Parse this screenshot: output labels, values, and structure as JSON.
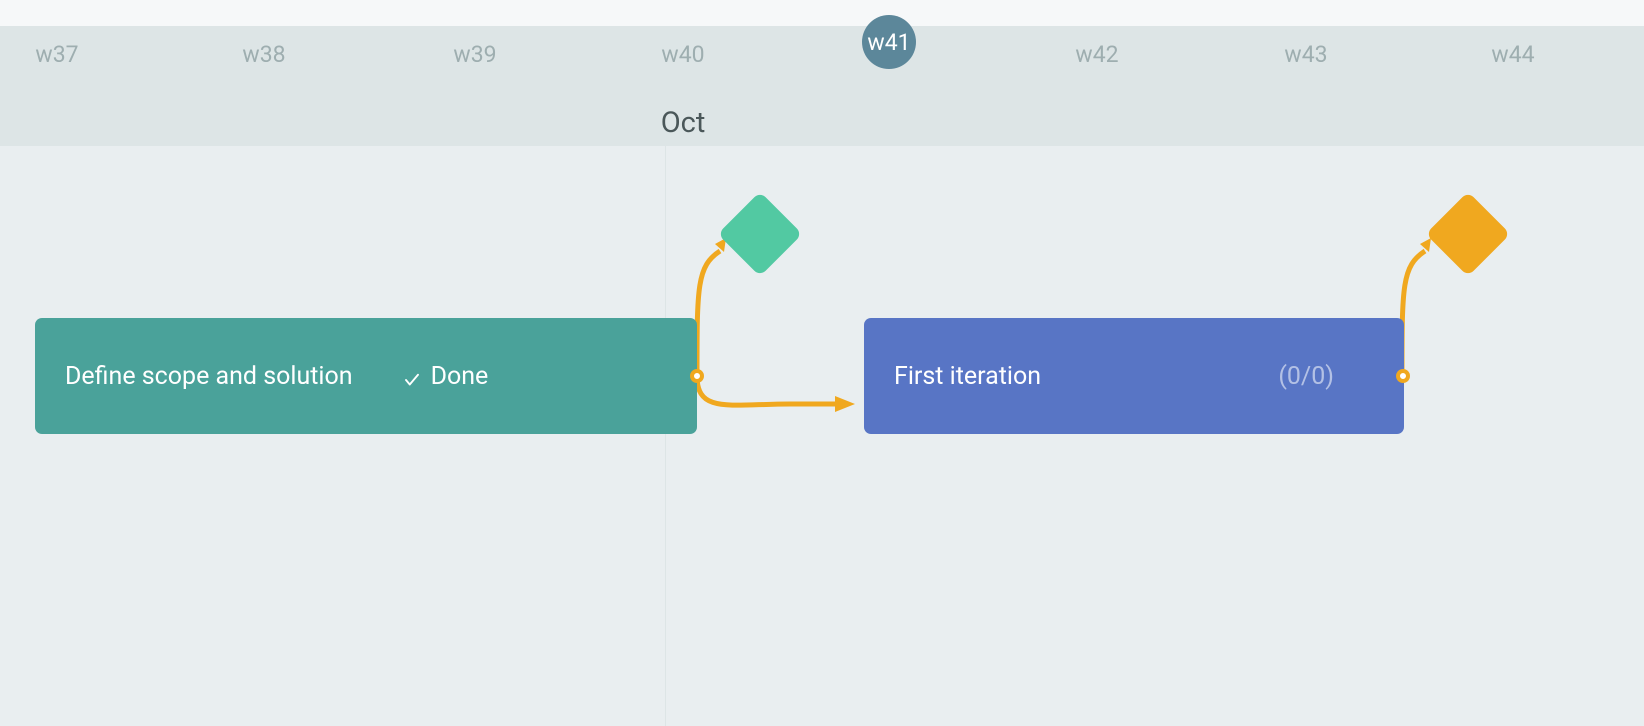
{
  "colors": {
    "accent_teal": "#4aa29a",
    "accent_blue": "#5875c5",
    "accent_orange": "#f0a81f",
    "milestone_green": "#52c9a2",
    "current_week_bg": "#5c879a"
  },
  "timeline": {
    "month_label": "Oct",
    "weeks": [
      {
        "label": "w37",
        "current": false
      },
      {
        "label": "w38",
        "current": false
      },
      {
        "label": "w39",
        "current": false
      },
      {
        "label": "w40",
        "current": false
      },
      {
        "label": "w41",
        "current": true
      },
      {
        "label": "w42",
        "current": false
      },
      {
        "label": "w43",
        "current": false
      },
      {
        "label": "w44",
        "current": false
      }
    ]
  },
  "tasks": [
    {
      "title": "Define scope and solution",
      "status": "Done",
      "status_icon": "check-icon",
      "color": "teal"
    },
    {
      "title": "First iteration",
      "progress": "(0/0)",
      "color": "blue"
    }
  ],
  "milestones": [
    {
      "color": "green"
    },
    {
      "color": "orange"
    }
  ]
}
